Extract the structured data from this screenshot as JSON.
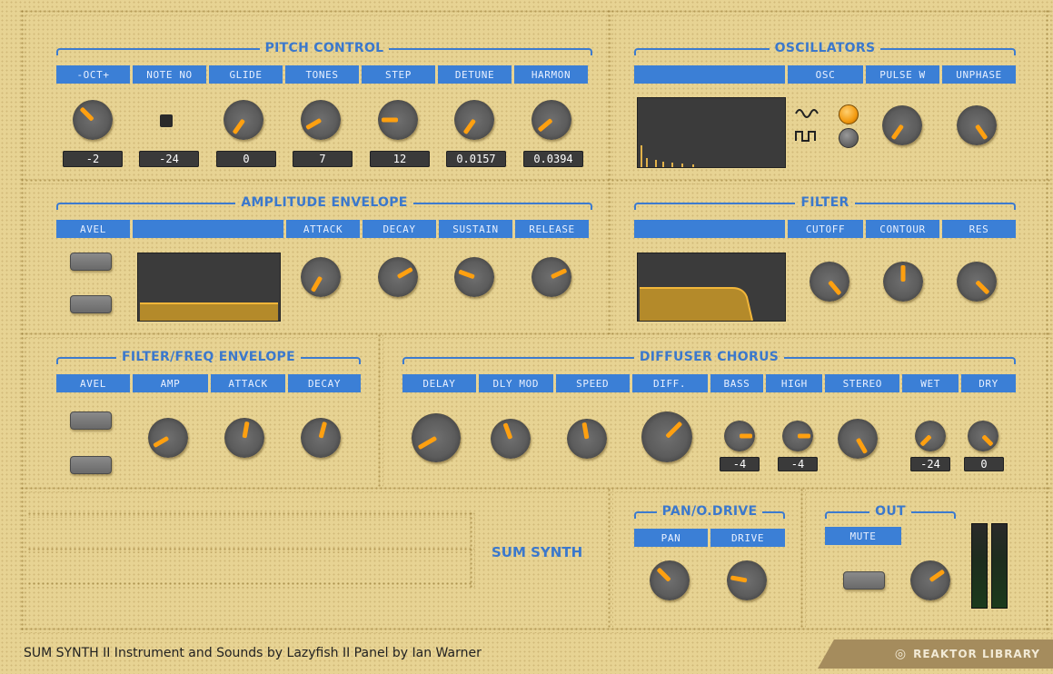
{
  "pitch_control": {
    "title": "PITCH CONTROL",
    "headers": [
      "-OCT+",
      "NOTE NO",
      "GLIDE",
      "TONES",
      "STEP",
      "DETUNE",
      "HARMON"
    ],
    "values": [
      "-2",
      "-24",
      "0",
      "7",
      "12",
      "0.0157",
      "0.0394"
    ]
  },
  "oscillators": {
    "title": "OSCILLATORS",
    "headers": [
      "",
      "OSC",
      "PULSE W",
      "UNPHASE"
    ],
    "wave_icons": [
      "sine-wave-icon",
      "square-wave-icon"
    ]
  },
  "amp_env": {
    "title": "AMPLITUDE ENVELOPE",
    "headers": [
      "AVEL",
      "",
      "ATTACK",
      "DECAY",
      "SUSTAIN",
      "RELEASE"
    ]
  },
  "filter": {
    "title": "FILTER",
    "headers": [
      "",
      "CUTOFF",
      "CONTOUR",
      "RES"
    ]
  },
  "filter_env": {
    "title": "FILTER/FREQ ENVELOPE",
    "headers": [
      "AVEL",
      "AMP",
      "ATTACK",
      "DECAY"
    ]
  },
  "chorus": {
    "title": "DIFFUSER CHORUS",
    "headers": [
      "DELAY",
      "DLY MOD",
      "SPEED",
      "DIFF.",
      "BASS",
      "HIGH",
      "STEREO",
      "WET",
      "DRY"
    ],
    "values": [
      "-4",
      "-4",
      "-24",
      "0"
    ]
  },
  "pan_drive": {
    "title": "PAN/O.DRIVE",
    "headers": [
      "PAN",
      "DRIVE"
    ]
  },
  "out": {
    "title": "OUT",
    "mute_label": "MUTE"
  },
  "center_label": "SUM SYNTH",
  "footer": {
    "text": "SUM SYNTH  II  Instrument and Sounds by Lazyfish  II  Panel by Ian Warner",
    "brand": "REAKTOR LIBRARY"
  },
  "colors": {
    "panel": "#e7d393",
    "accent_blue": "#3b7fd6",
    "indicator_orange": "#ffa010",
    "display_bg": "#3b3b3b"
  }
}
